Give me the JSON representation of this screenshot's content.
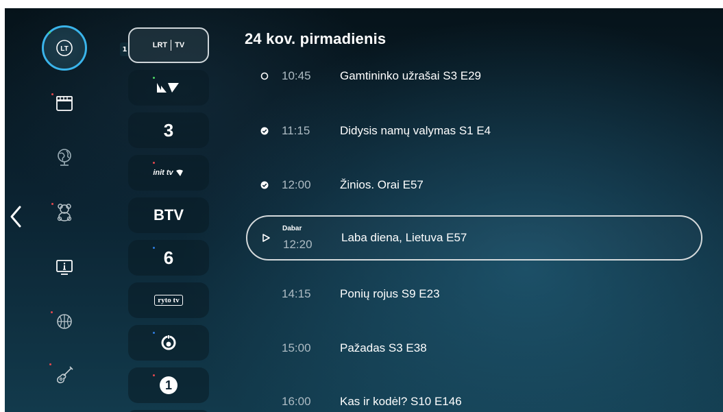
{
  "colors": {
    "accent": "#3ab4ea",
    "background_top": "#06131a",
    "background_bottom": "#123a4c",
    "time_text": "#aebcc4",
    "dot_green": "#4cd964",
    "dot_red": "#e5484d",
    "dot_blue": "#2f7de1"
  },
  "categories": [
    {
      "icon": "lt-channels-icon",
      "label": "LT",
      "selected": true,
      "dot": "green"
    },
    {
      "icon": "movie-clapperboard-icon",
      "selected": false,
      "dot": "red"
    },
    {
      "icon": "globe-icon",
      "selected": false,
      "dot": "none"
    },
    {
      "icon": "teddy-bear-icon",
      "selected": false,
      "dot": "red"
    },
    {
      "icon": "info-tv-icon",
      "selected": false,
      "dot": "none"
    },
    {
      "icon": "basketball-icon",
      "selected": false,
      "dot": "red"
    },
    {
      "icon": "guitar-icon",
      "selected": false,
      "dot": "red"
    }
  ],
  "channels": [
    {
      "number": "1",
      "logo_left": "LRT",
      "logo_right": "TV",
      "icon": "lrt-tv-logo",
      "selected": true,
      "dot": "none"
    },
    {
      "logo": "",
      "icon": "tv3-birds-logo",
      "selected": false,
      "dot": "green"
    },
    {
      "logo": "3",
      "icon": "tv3-logo",
      "selected": false,
      "dot": "none"
    },
    {
      "logo": "init tv",
      "icon": "init-tv-logo",
      "selected": false,
      "dot": "red"
    },
    {
      "logo": "BTV",
      "icon": "btv-logo",
      "selected": false,
      "dot": "none"
    },
    {
      "logo": "6",
      "icon": "tv6-logo",
      "selected": false,
      "dot": "blue"
    },
    {
      "logo": "ryto tv",
      "icon": "lietuvos-ryto-tv-logo",
      "selected": false,
      "dot": "none"
    },
    {
      "logo": "",
      "icon": "tv8-logo",
      "selected": false,
      "dot": "blue"
    },
    {
      "logo": "1",
      "icon": "tv1-logo",
      "selected": false,
      "dot": "red"
    }
  ],
  "schedule": {
    "date": "24 kov. pirmadienis",
    "now_label": "Dabar",
    "programs": [
      {
        "time": "10:45",
        "title": "Gamtininko užrašai S3 E29",
        "status": "circle-outline-icon",
        "current": false
      },
      {
        "time": "11:15",
        "title": "Didysis namų valymas S1 E4",
        "status": "check-circle-icon",
        "current": false
      },
      {
        "time": "12:00",
        "title": "Žinios. Orai E57",
        "status": "check-circle-icon",
        "current": false
      },
      {
        "time": "12:20",
        "title": "Laba diena, Lietuva E57",
        "status": "play-outline-icon",
        "current": true
      },
      {
        "time": "14:15",
        "title": "Ponių rojus S9 E23",
        "status": "",
        "current": false
      },
      {
        "time": "15:00",
        "title": "Pažadas S3 E38",
        "status": "",
        "current": false
      },
      {
        "time": "16:00",
        "title": "Kas ir kodėl? S10 E146",
        "status": "",
        "current": false
      }
    ]
  }
}
